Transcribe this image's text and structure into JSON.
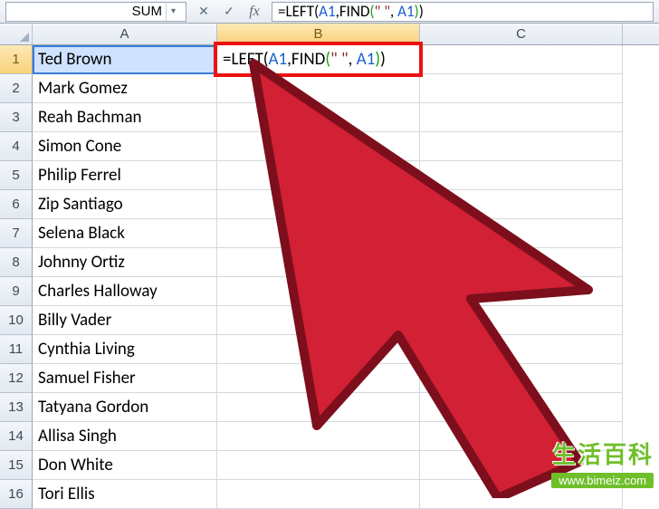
{
  "name_box": "SUM",
  "formula_bar_buttons": {
    "cancel": "✕",
    "enter": "✓",
    "fx": "fx"
  },
  "formula_text": {
    "eq": "=",
    "fn1": "LEFT",
    "lp1": "(",
    "ref1": "A1",
    "comma1": ",",
    "fn2": "FIND",
    "lp2": "(",
    "str": "\" \"",
    "comma2": ", ",
    "ref2": "A1",
    "rp2": ")",
    "rp1": ")"
  },
  "columns": [
    "A",
    "B",
    "C"
  ],
  "rows": [
    {
      "n": 1,
      "A": "Ted Brown"
    },
    {
      "n": 2,
      "A": "Mark Gomez"
    },
    {
      "n": 3,
      "A": "Reah Bachman"
    },
    {
      "n": 4,
      "A": "Simon Cone"
    },
    {
      "n": 5,
      "A": "Philip Ferrel"
    },
    {
      "n": 6,
      "A": "Zip Santiago"
    },
    {
      "n": 7,
      "A": "Selena Black"
    },
    {
      "n": 8,
      "A": "Johnny Ortiz"
    },
    {
      "n": 9,
      "A": "Charles Halloway"
    },
    {
      "n": 10,
      "A": "Billy Vader"
    },
    {
      "n": 11,
      "A": "Cynthia Living"
    },
    {
      "n": 12,
      "A": "Samuel Fisher"
    },
    {
      "n": 13,
      "A": "Tatyana Gordon"
    },
    {
      "n": 14,
      "A": "Allisa Singh"
    },
    {
      "n": 15,
      "A": "Don White"
    },
    {
      "n": 16,
      "A": "Tori Ellis"
    }
  ],
  "active_cell": "B1",
  "watermark": {
    "line1": "生活百科",
    "line2": "www.bimeiz.com"
  }
}
